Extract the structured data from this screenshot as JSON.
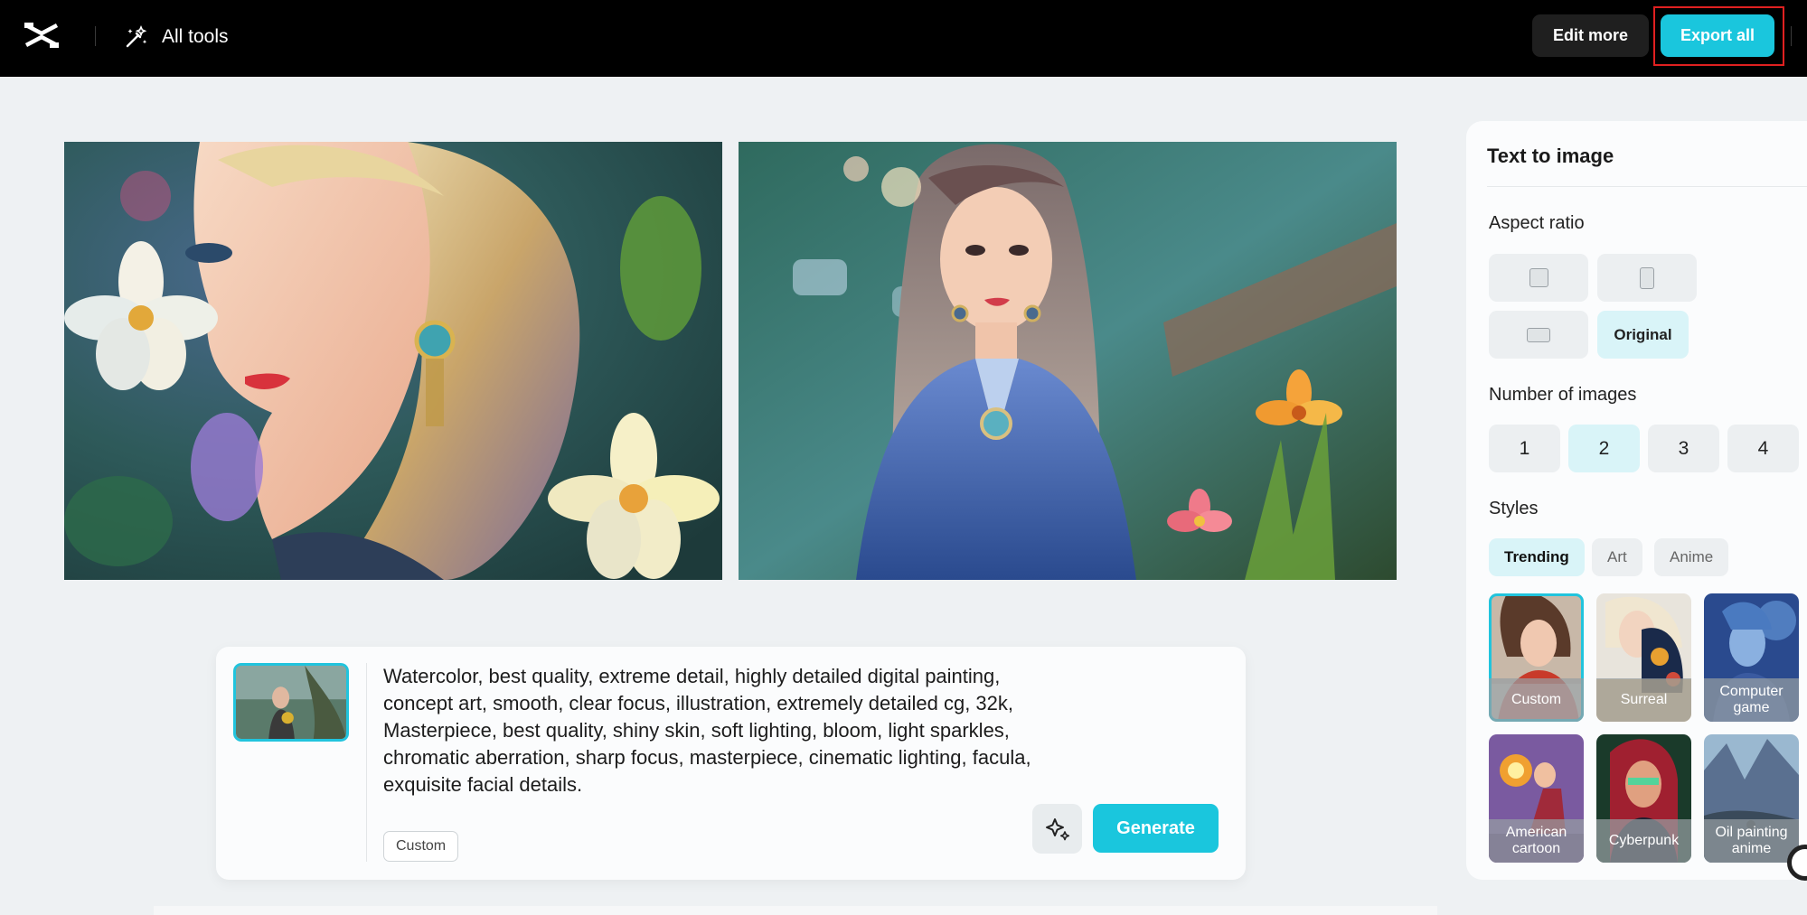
{
  "topbar": {
    "all_tools_label": "All tools",
    "edit_more_label": "Edit more",
    "export_all_label": "Export all",
    "logo_icon": "capcut-logo-icon",
    "tools_icon": "magic-wand-icon",
    "accent_color": "#1ac6dd"
  },
  "canvas": {
    "images": [
      {
        "icon": "generated-image-watercolor-woman-profile"
      },
      {
        "icon": "generated-image-woman-in-blue-robe"
      }
    ]
  },
  "prompt": {
    "text": "Watercolor, best quality, extreme detail, highly detailed digital painting, concept art, smooth, clear focus, illustration, extremely detailed cg, 32k, Masterpiece, best quality, shiny skin, soft lighting, bloom, light sparkles, chromatic aberration, sharp focus, masterpiece, cinematic lighting, facula, exquisite facial details.",
    "style_chip": "Custom",
    "generate_label": "Generate",
    "magic_icon": "sparkle-icon"
  },
  "panel": {
    "title": "Text to image",
    "aspect_ratio_label": "Aspect ratio",
    "aspect_options": [
      {
        "icon": "square-ratio-icon"
      },
      {
        "icon": "portrait-ratio-icon"
      },
      {
        "icon": "landscape-ratio-icon"
      },
      {
        "label": "Original"
      }
    ],
    "number_label": "Number of images",
    "numbers": [
      "1",
      "2",
      "3",
      "4"
    ],
    "selected_number": "2",
    "styles_label": "Styles",
    "style_tabs": [
      "Trending",
      "Art",
      "Anime"
    ],
    "selected_tab": "Trending",
    "style_cards": [
      {
        "label": "Custom"
      },
      {
        "label": "Surreal"
      },
      {
        "label": "Computer game"
      },
      {
        "label": "American cartoon"
      },
      {
        "label": "Cyberpunk"
      },
      {
        "label": "Oil painting anime"
      }
    ],
    "selected_style": "Custom"
  }
}
